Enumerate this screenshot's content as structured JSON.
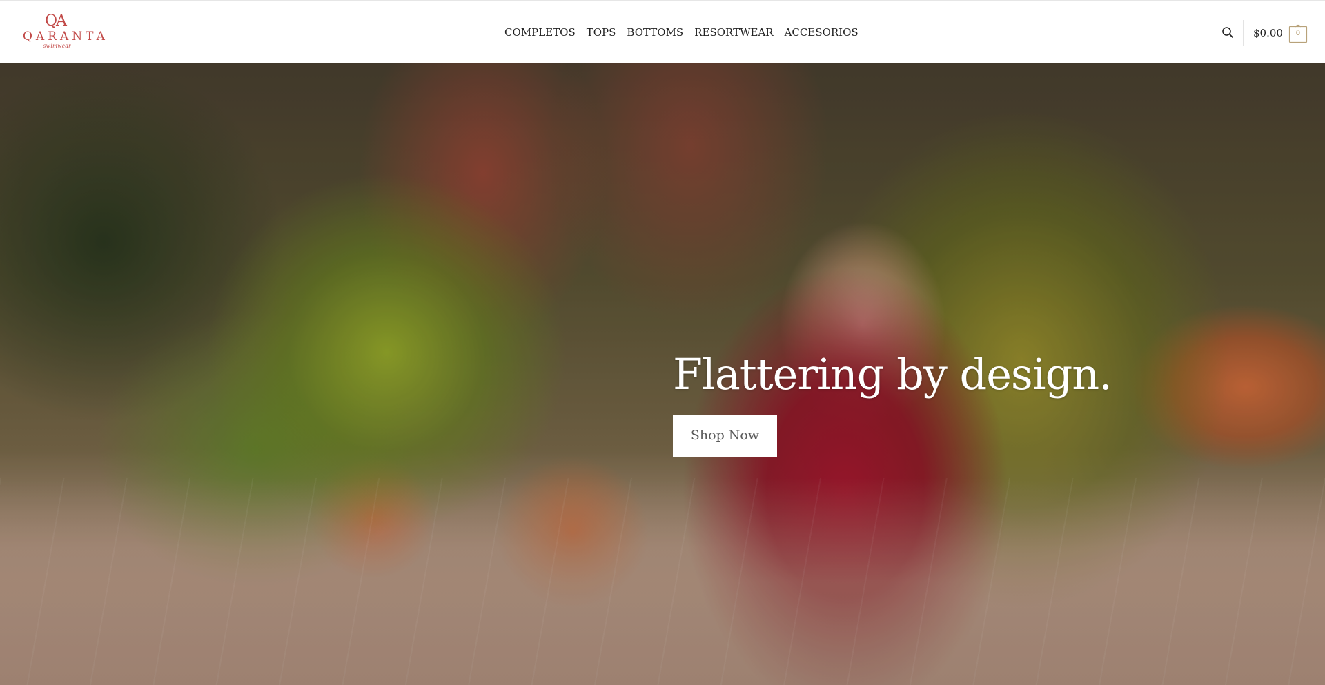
{
  "brand": {
    "name": "QARANTA",
    "tagline": "swimwear",
    "color": "#c24a48"
  },
  "nav": {
    "items": [
      {
        "label": "COMPLETOS"
      },
      {
        "label": "TOPS"
      },
      {
        "label": "BOTTOMS"
      },
      {
        "label": "RESORTWEAR"
      },
      {
        "label": "ACCESORIOS"
      }
    ]
  },
  "header_actions": {
    "search_icon": "search-icon",
    "cart_total": "$0.00",
    "cart_count": "0",
    "cart_icon": "shopping-bag-icon"
  },
  "hero": {
    "headline": "Flattering by design.",
    "cta_label": "Shop Now",
    "image_description_icon": "hero-photo"
  }
}
